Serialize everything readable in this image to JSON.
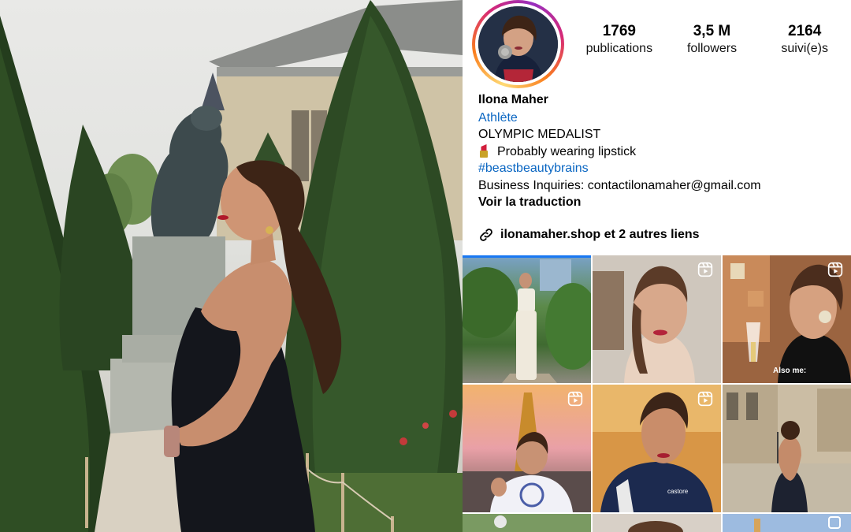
{
  "profile": {
    "name": "Ilona Maher",
    "category": "Athlète",
    "bio_line_1": "OLYMPIC MEDALIST",
    "bio_line_2": "Probably wearing lipstick",
    "hashtag": "#beastbeautybrains",
    "bio_line_4": "Business Inquiries: contactilonamaher@gmail.com",
    "translate_label": "Voir la traduction",
    "links_label": "ilonamaher.shop et 2 autres liens"
  },
  "stats": [
    {
      "value": "1769",
      "label": "publications"
    },
    {
      "value": "3,5 M",
      "label": "followers"
    },
    {
      "value": "2164",
      "label": "suivi(e)s"
    }
  ],
  "grid": {
    "caption_tile_3": "Also me:"
  },
  "icons": {
    "link": "link-icon",
    "reel": "reel-icon",
    "lipstick": "lipstick-emoji"
  },
  "colors": {
    "link_blue": "#0a66c2",
    "ring_start": "#feda75",
    "ring_mid": "#d62976",
    "ring_end": "#962fbf"
  }
}
